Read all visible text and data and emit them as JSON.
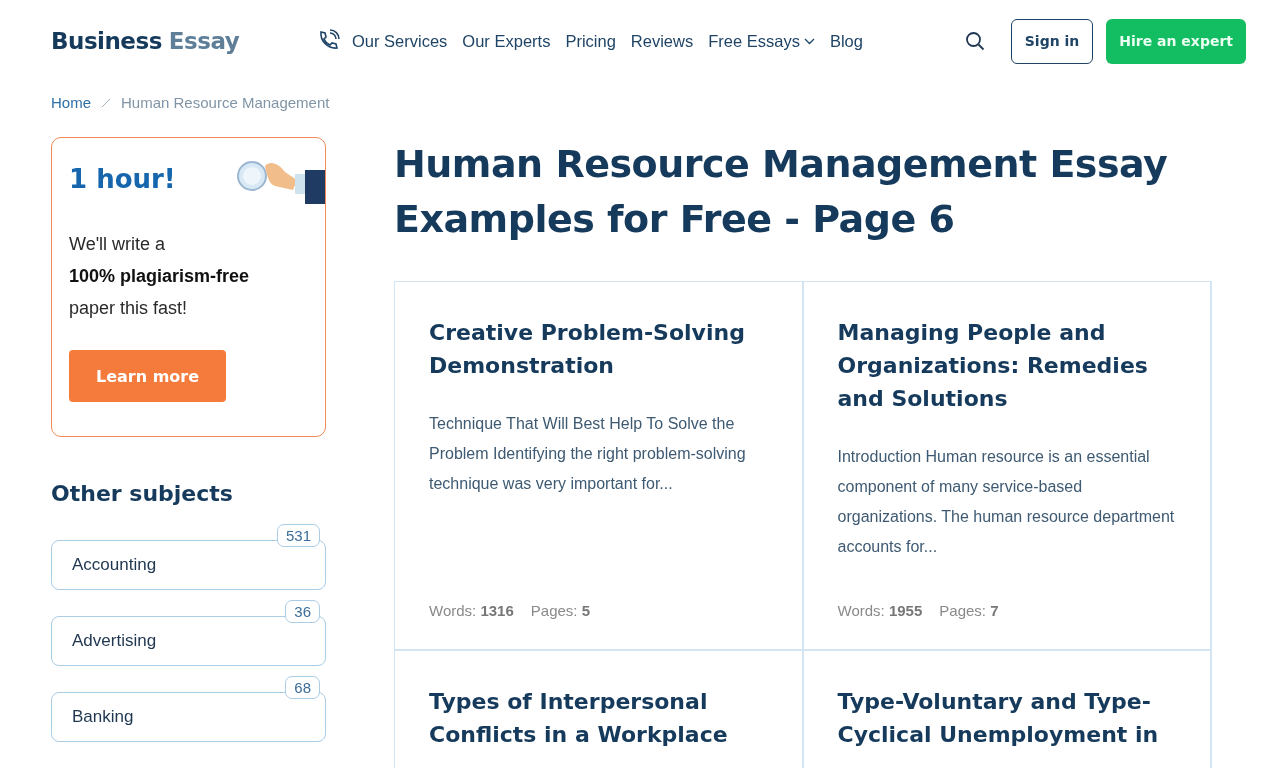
{
  "header": {
    "logo": {
      "part_1": "Business",
      "part_2": "Essay"
    },
    "nav": [
      {
        "label": "Our Services",
        "dropdown": false
      },
      {
        "label": "Our Experts",
        "dropdown": false
      },
      {
        "label": "Pricing",
        "dropdown": false
      },
      {
        "label": "Reviews",
        "dropdown": false
      },
      {
        "label": "Free Essays",
        "dropdown": true
      },
      {
        "label": "Blog",
        "dropdown": false
      }
    ],
    "sign_in": "Sign in",
    "hire": "Hire an expert"
  },
  "breadcrumb": [
    {
      "label": "Home",
      "link": true
    },
    {
      "label": "Human Resource Management",
      "link": false
    }
  ],
  "promo": {
    "title": "1 hour!",
    "text": "We'll write a\n**100% plagiarism-free**\npaper this fast!",
    "button": "Learn more"
  },
  "subjects": {
    "title": "Other subjects",
    "items": [
      {
        "label": "Accounting",
        "count": "531"
      },
      {
        "label": "Advertising",
        "count": "36"
      },
      {
        "label": "Banking",
        "count": "68"
      }
    ]
  },
  "page_title": "Human Resource Management Essay Examples for Free - Page 6",
  "essays": [
    {
      "title": "Creative Problem-Solving Demonstration",
      "excerpt": "Technique That Will Best Help To Solve the Problem Identifying the right problem-solving technique was very important for...",
      "words": "Words: **1316**",
      "pages": "Pages: **5**"
    },
    {
      "title": "Managing People and Organizations: Remedies and Solutions",
      "excerpt": "Introduction Human resource is an essential component of many service-based organizations. The human resource department accounts for...",
      "words": "Words: **1955**",
      "pages": "Pages: **7**"
    },
    {
      "title": "Types of Interpersonal Conflicts in a Workplace"
    },
    {
      "title": "Type-Voluntary and Type-Cyclical Unemployment in"
    }
  ]
}
